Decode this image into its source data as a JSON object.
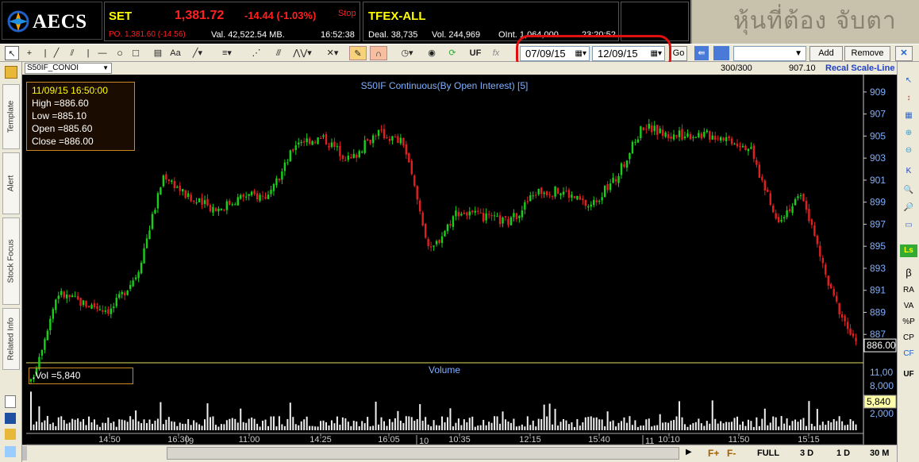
{
  "brand_logo_text": "AECS",
  "brand_banner_text": "หุ้นที่ต้อง จับตา",
  "set_panel": {
    "name": "SET",
    "price": "1,381.72",
    "change": "-14.44 (-1.03%)",
    "status": "Stop",
    "po": "PO. 1,381.60 (-14.56)",
    "val": "Val. 42,522.54 MB.",
    "time": "16:52:38"
  },
  "tfex_panel": {
    "name": "TFEX-ALL",
    "deal": "Deal. 38,735",
    "vol": "Vol. 244,969",
    "oint": "OInt. 1,064,000",
    "time": "23:20:52"
  },
  "toolbar": {
    "font_btn": "Aa",
    "uf_btn": "UF",
    "fx_btn": "fx",
    "date_from": "07/09/15",
    "date_to": "12/09/15",
    "go_label": "Go",
    "add_label": "Add",
    "remove_label": "Remove",
    "close_glyph": "✕"
  },
  "symbol_select": "S50IF_CONOI",
  "bar_count": "300/300",
  "last_price_header": "907.10",
  "recal_label": "Recal Scale-Line",
  "side_tabs": [
    "Template",
    "Alert",
    "Stock Focus",
    "Related Info"
  ],
  "right_tools": [
    "β",
    "RA",
    "VA",
    "%P",
    "CP",
    "CF",
    "UF"
  ],
  "chart_data": {
    "type": "candlestick",
    "title": "S50IF Continuous(By Open Interest) [5]",
    "info_box": {
      "datetime": "11/09/15 16:50:00",
      "high": "High  =886.60",
      "low": "Low   =885.10",
      "open": "Open  =885.60",
      "close": "Close  =886.00"
    },
    "y_ticks": [
      909,
      907,
      905,
      903,
      901,
      899,
      897,
      895,
      893,
      891,
      889,
      887
    ],
    "ylim": [
      885.0,
      910.0
    ],
    "last_close_label": "886.00",
    "anchor_closes": [
      882.6,
      890.8,
      889.8,
      889.2,
      892.6,
      901.6,
      899.2,
      898.4,
      899.6,
      899.6,
      904.6,
      904.8,
      902.8,
      905.4,
      904.4,
      894.4,
      898.2,
      897.6,
      897.2,
      900.0,
      900.0,
      898.6,
      901.2,
      906.0,
      905.0,
      905.2,
      905.0,
      904.0,
      897.4,
      899.6,
      891.2,
      886.0
    ],
    "volume_title": "Volume",
    "volume_label": ".Vol   =5,840",
    "volume_ticks": [
      "11,00",
      "8,000",
      "5,840",
      "2,000"
    ],
    "x_labels": [
      "14:50",
      "16:30",
      "11:00",
      "14:25",
      "16:05",
      "10:35",
      "12:15",
      "15:40",
      "10:10",
      "11:50",
      "15:15"
    ],
    "day_labels": [
      "9",
      "10",
      "11"
    ]
  },
  "bottom_tabs": [
    "F+",
    "F-",
    "FULL",
    "3 D",
    "1 D",
    "30 M"
  ]
}
